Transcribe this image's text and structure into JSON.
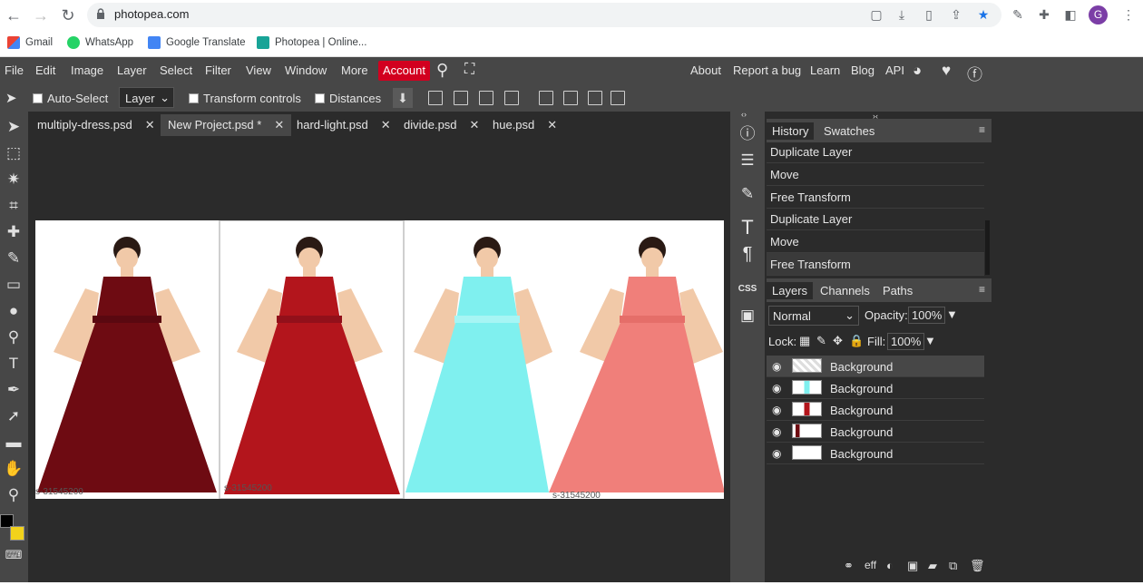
{
  "browser": {
    "url": "photopea.com",
    "avatar_letter": "G",
    "bookmarks": [
      "Gmail",
      "WhatsApp",
      "Google Translate",
      "Photopea | Online..."
    ]
  },
  "menu": {
    "items": [
      "File",
      "Edit",
      "Image",
      "Layer",
      "Select",
      "Filter",
      "View",
      "Window",
      "More"
    ],
    "account": "Account",
    "right_items": [
      "About",
      "Report a bug",
      "Learn",
      "Blog",
      "API"
    ]
  },
  "options": {
    "auto_select": "Auto-Select",
    "layer_select": "Layer",
    "transform_controls": "Transform controls",
    "distances": "Distances"
  },
  "tabs": [
    {
      "label": "multiply-dress.psd",
      "active": false
    },
    {
      "label": "New Project.psd *",
      "active": true
    },
    {
      "label": "hard-light.psd",
      "active": false
    },
    {
      "label": "divide.psd",
      "active": false
    },
    {
      "label": "hue.psd",
      "active": false
    }
  ],
  "history_panel": {
    "tabs": [
      "History",
      "Swatches"
    ],
    "items": [
      "Duplicate Layer",
      "Move",
      "Free Transform",
      "Duplicate Layer",
      "Move",
      "Free Transform"
    ]
  },
  "layers_panel": {
    "tabs": [
      "Layers",
      "Channels",
      "Paths"
    ],
    "blend_mode": "Normal",
    "opacity_label": "Opacity:",
    "opacity": "100%",
    "lock_label": "Lock:",
    "fill_label": "Fill:",
    "fill": "100%",
    "layers": [
      "Background",
      "Background",
      "Background",
      "Background",
      "Background"
    ]
  },
  "canvas": {
    "watermarks": [
      "s-31545200",
      "s-31545200",
      "s-31545200"
    ],
    "dress_colors": [
      "#6e0b12",
      "#b3151c",
      "#7ff0ef",
      "#f07f7a"
    ]
  },
  "dock_labels": {
    "css": "CSS"
  },
  "colors": {
    "accent": "#d2001f",
    "menu_bg": "#474747",
    "workspace_bg": "#2b2b2b"
  }
}
